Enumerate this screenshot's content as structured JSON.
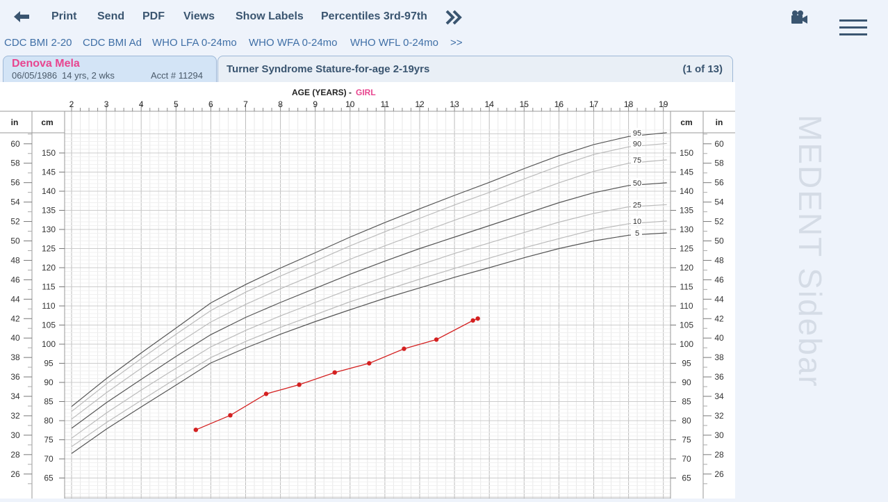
{
  "toolbar": {
    "print": "Print",
    "send": "Send",
    "pdf": "PDF",
    "views": "Views",
    "show_labels": "Show Labels",
    "percentiles": "Percentiles 3rd-97th"
  },
  "chart_links": [
    "CDC BMI 2-20",
    "CDC BMI Ad",
    "WHO LFA 0-24mo",
    "WHO WFA 0-24mo",
    "WHO WFL 0-24mo",
    ">>"
  ],
  "patient": {
    "name": "Denova Mela",
    "dob": "06/05/1986",
    "age": "14 yrs, 2 wks",
    "acct": "Acct # 11294"
  },
  "chart_tab": {
    "title": "Turner Syndrome Stature-for-age 2-19yrs",
    "page": "(1 of 13)"
  },
  "sidebar": {
    "label": "MEDENT Sidebar"
  },
  "colors": {
    "accent": "#3a5570",
    "link": "#3f6fa6",
    "patient_name": "#e8458f",
    "patient_line": "#d42020"
  },
  "icons": [
    "back-arrow-icon",
    "double-chevron-right-icon",
    "video-camera-icon",
    "hamburger-menu-icon"
  ],
  "chart_data": {
    "type": "line",
    "title": "AGE (YEARS)",
    "gender_label": "GIRL",
    "xlim": [
      2,
      19
    ],
    "x_ticks": [
      2,
      3,
      4,
      5,
      6,
      7,
      8,
      9,
      10,
      11,
      12,
      13,
      14,
      15,
      16,
      17,
      18,
      19
    ],
    "left_unit_in": "in",
    "left_unit_cm": "cm",
    "right_unit_cm": "cm",
    "right_unit_in": "in",
    "cm_ticks": [
      65,
      70,
      75,
      80,
      85,
      90,
      95,
      100,
      105,
      110,
      115,
      120,
      125,
      130,
      135,
      140,
      145,
      150
    ],
    "in_ticks": [
      26,
      28,
      30,
      32,
      34,
      36,
      38,
      40,
      42,
      44,
      46,
      48,
      50,
      52,
      54,
      56,
      58,
      60
    ],
    "ylim_cm": [
      62,
      155
    ],
    "percentiles": [
      {
        "name": "95",
        "x": [
          2,
          3,
          4,
          5,
          6,
          7,
          8,
          9,
          10,
          11,
          12,
          13,
          14,
          15,
          16,
          17,
          18,
          19.1
        ],
        "y": [
          83.7,
          91.0,
          97.7,
          104.2,
          110.8,
          115.6,
          119.9,
          123.9,
          128.0,
          131.8,
          135.4,
          138.9,
          142.3,
          145.9,
          149.3,
          152.2,
          154.3,
          155.3
        ]
      },
      {
        "name": "90",
        "x": [
          2,
          3,
          4,
          5,
          6,
          7,
          8,
          9,
          10,
          11,
          12,
          13,
          14,
          15,
          16,
          17,
          18,
          19.1
        ],
        "y": [
          82.4,
          89.6,
          96.2,
          102.6,
          108.8,
          113.6,
          117.8,
          121.7,
          125.7,
          129.4,
          132.9,
          136.4,
          139.7,
          143.2,
          146.6,
          149.6,
          151.6,
          152.5
        ]
      },
      {
        "name": "75",
        "x": [
          2,
          3,
          4,
          5,
          6,
          7,
          8,
          9,
          10,
          11,
          12,
          13,
          14,
          15,
          16,
          17,
          18,
          19.1
        ],
        "y": [
          80.4,
          87.3,
          93.7,
          99.9,
          105.8,
          110.4,
          114.5,
          118.3,
          122.2,
          125.7,
          129.1,
          132.4,
          135.6,
          138.9,
          142.2,
          145.2,
          147.3,
          148.2
        ]
      },
      {
        "name": "50",
        "x": [
          2,
          3,
          4,
          5,
          6,
          7,
          8,
          9,
          10,
          11,
          12,
          13,
          14,
          15,
          16,
          17,
          18,
          19.1
        ],
        "y": [
          78.0,
          84.7,
          90.8,
          96.8,
          102.5,
          107.0,
          110.9,
          114.6,
          118.3,
          121.7,
          125.0,
          128.0,
          131.0,
          134.0,
          137.0,
          139.6,
          141.5,
          142.2
        ]
      },
      {
        "name": "25",
        "x": [
          2,
          3,
          4,
          5,
          6,
          7,
          8,
          9,
          10,
          11,
          12,
          13,
          14,
          15,
          16,
          17,
          18,
          19.1
        ],
        "y": [
          75.4,
          82.0,
          88.0,
          93.7,
          99.3,
          103.6,
          107.4,
          110.9,
          114.4,
          117.6,
          120.7,
          123.7,
          126.5,
          129.2,
          131.9,
          134.2,
          135.9,
          136.5
        ]
      },
      {
        "name": "10",
        "x": [
          2,
          3,
          4,
          5,
          6,
          7,
          8,
          9,
          10,
          11,
          12,
          13,
          14,
          15,
          16,
          17,
          18,
          19.1
        ],
        "y": [
          73.2,
          79.5,
          85.3,
          91.0,
          96.5,
          100.7,
          104.4,
          107.7,
          111.1,
          114.1,
          117.0,
          119.8,
          122.5,
          125.2,
          127.6,
          129.9,
          131.5,
          132.2
        ]
      },
      {
        "name": "5",
        "x": [
          2,
          3,
          4,
          5,
          6,
          7,
          8,
          9,
          10,
          11,
          12,
          13,
          14,
          15,
          16,
          17,
          18,
          19.1
        ],
        "y": [
          71.4,
          77.8,
          83.6,
          89.3,
          95.1,
          99.0,
          102.6,
          105.9,
          109.0,
          112.0,
          114.7,
          117.5,
          120.0,
          122.6,
          125.0,
          127.0,
          128.5,
          129.1
        ]
      }
    ],
    "patient_series": {
      "name": "Denova Mela",
      "x": [
        5.57,
        6.56,
        7.59,
        8.54,
        9.56,
        10.55,
        11.55,
        12.48,
        13.53,
        13.67
      ],
      "y": [
        77.6,
        81.4,
        87.0,
        89.4,
        92.6,
        95.0,
        98.8,
        101.2,
        106.2,
        106.7
      ]
    }
  }
}
